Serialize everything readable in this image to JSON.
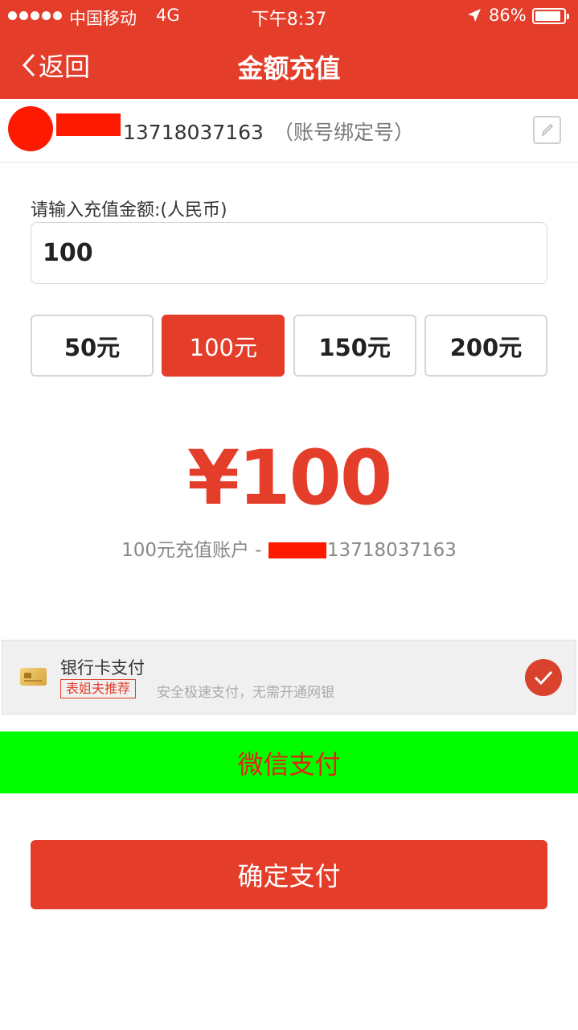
{
  "status_bar": {
    "carrier": "中国移动",
    "network": "4G",
    "time": "下午8:37",
    "battery": "86%",
    "battery_level": 0.86
  },
  "nav": {
    "back_label": "返回",
    "title": "金额充值"
  },
  "account": {
    "number": "13718037163",
    "note": "（账号绑定号）"
  },
  "amount": {
    "label": "请输入充值金额:(人民币)",
    "value": "100"
  },
  "presets": [
    {
      "label": "50元",
      "selected": false
    },
    {
      "label": "100元",
      "selected": true
    },
    {
      "label": "150元",
      "selected": false
    },
    {
      "label": "200元",
      "selected": false
    }
  ],
  "summary": {
    "big_amount": "¥100",
    "prefix": "100元充值账户 - ",
    "account": "13718037163"
  },
  "payment": {
    "bank": {
      "title": "银行卡支付",
      "badge": "表姐夫推荐",
      "desc": "安全极速支付，无需开通网银",
      "selected": true
    },
    "wechat": {
      "title": "微信支付"
    }
  },
  "confirm_label": "确定支付",
  "colors": {
    "primary": "#e43d2a",
    "wechat_bg": "#00fe00",
    "wechat_text": "#e22410",
    "redaction": "#fe1a00"
  }
}
